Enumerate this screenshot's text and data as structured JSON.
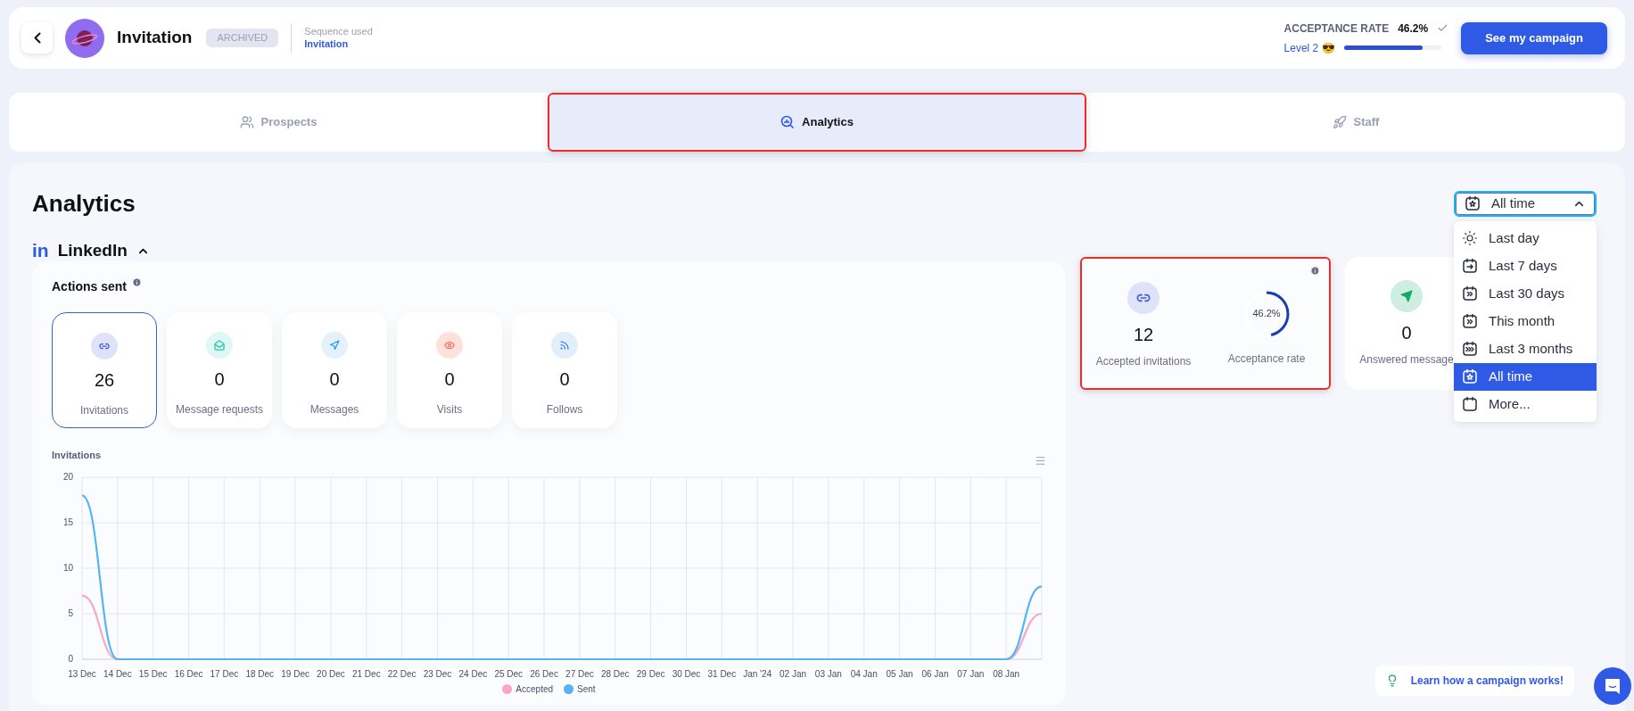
{
  "header": {
    "campaign_name": "Invitation",
    "status_badge": "ARCHIVED",
    "sequence_label": "Sequence used",
    "sequence_name": "Invitation",
    "acceptance_rate_label": "ACCEPTANCE RATE",
    "acceptance_rate_value": "46.2%",
    "level_label": "Level 2 😎",
    "level": 0.81,
    "cta_button": "See my campaign"
  },
  "tabs": [
    {
      "label": "Prospects",
      "selected": false
    },
    {
      "label": "Analytics",
      "selected": true
    },
    {
      "label": "Staff",
      "selected": false
    }
  ],
  "analytics": {
    "title": "Analytics",
    "period_select": {
      "value": "All time",
      "expanded": true,
      "options": [
        {
          "label": "Last day",
          "selected": false
        },
        {
          "label": "Last 7 days",
          "selected": false
        },
        {
          "label": "Last 30 days",
          "selected": false
        },
        {
          "label": "This month",
          "selected": false
        },
        {
          "label": "Last 3 months",
          "selected": false
        },
        {
          "label": "All time",
          "selected": true
        },
        {
          "label": "More...",
          "selected": false
        }
      ]
    },
    "network": {
      "logo_text": "in",
      "name": "LinkedIn",
      "expanded": true
    },
    "actions_sent": {
      "title": "Actions sent",
      "cards": [
        {
          "value": "26",
          "label": "Invitations",
          "selected": true
        },
        {
          "value": "0",
          "label": "Message requests",
          "selected": false
        },
        {
          "value": "0",
          "label": "Messages",
          "selected": false
        },
        {
          "value": "0",
          "label": "Visits",
          "selected": false
        },
        {
          "value": "0",
          "label": "Follows",
          "selected": false
        }
      ]
    },
    "invitations_chart": {
      "title": "Invitations",
      "chart_data": {
        "type": "line",
        "categories": [
          "13 Dec",
          "14 Dec",
          "15 Dec",
          "16 Dec",
          "17 Dec",
          "18 Dec",
          "19 Dec",
          "20 Dec",
          "21 Dec",
          "22 Dec",
          "23 Dec",
          "24 Dec",
          "25 Dec",
          "26 Dec",
          "27 Dec",
          "28 Dec",
          "29 Dec",
          "30 Dec",
          "31 Dec",
          "Jan '24",
          "02 Jan",
          "03 Jan",
          "04 Jan",
          "05 Jan",
          "06 Jan",
          "07 Jan",
          "08 Jan",
          null
        ],
        "ylim": [
          0,
          20
        ],
        "yticks": [
          0,
          5,
          10,
          15,
          20
        ],
        "grid": true,
        "legend": true,
        "series": [
          {
            "name": "Accepted",
            "color": "#f7a8c8",
            "values": [
              7,
              0,
              null,
              null,
              null,
              null,
              null,
              null,
              null,
              null,
              null,
              null,
              null,
              null,
              null,
              null,
              null,
              null,
              null,
              null,
              null,
              null,
              null,
              null,
              null,
              null,
              0,
              5
            ]
          },
          {
            "name": "Sent",
            "color": "#55b4f8",
            "values": [
              18,
              0,
              0,
              0,
              0,
              0,
              0,
              0,
              0,
              0,
              0,
              0,
              0,
              0,
              0,
              0,
              0,
              0,
              0,
              0,
              0,
              0,
              0,
              0,
              0,
              0,
              0,
              8
            ]
          }
        ]
      }
    },
    "stat_cards": [
      {
        "highlighted": true,
        "items": [
          {
            "kind": "count",
            "value": "12",
            "label": "Accepted invitations"
          },
          {
            "kind": "ring",
            "value": "46.2%",
            "level": 0.462,
            "label": "Acceptance rate"
          }
        ]
      },
      {
        "highlighted": false,
        "items": [
          {
            "kind": "count",
            "value": "0",
            "label": "Answered message"
          }
        ]
      }
    ]
  },
  "help_link": "Learn how a campaign works!"
}
